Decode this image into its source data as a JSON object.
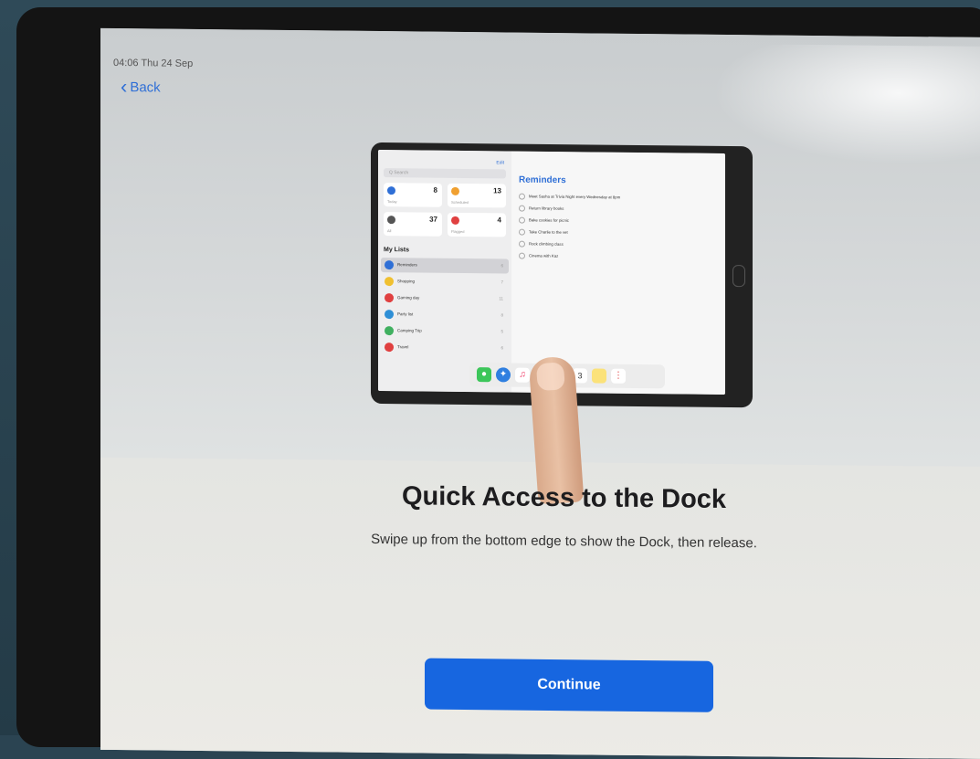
{
  "status_bar": {
    "time_date": "04:06  Thu 24 Sep"
  },
  "nav": {
    "back_label": "Back"
  },
  "illustration": {
    "sidebar": {
      "edit": "Edit",
      "search": "Q Search",
      "tiles": [
        {
          "label": "Today",
          "count": "8",
          "color": "#2f6fd6"
        },
        {
          "label": "Scheduled",
          "count": "13",
          "color": "#f0a030"
        },
        {
          "label": "All",
          "count": "37",
          "color": "#555555"
        },
        {
          "label": "Flagged",
          "count": "4",
          "color": "#e04040"
        }
      ],
      "my_lists_heading": "My Lists",
      "lists": [
        {
          "name": "Reminders",
          "count": "6",
          "color": "#2f6fd6"
        },
        {
          "name": "Shopping",
          "count": "7",
          "color": "#f0c030"
        },
        {
          "name": "Gaming day",
          "count": "11",
          "color": "#e04040"
        },
        {
          "name": "Party list",
          "count": "8",
          "color": "#2f8fd6"
        },
        {
          "name": "Camping Trip",
          "count": "5",
          "color": "#40b060"
        },
        {
          "name": "Travel",
          "count": "6",
          "color": "#e04040"
        }
      ]
    },
    "reminders": {
      "title": "Reminders",
      "items": [
        "Meet Sasha at Trivia Night every Wednesday at 8pm",
        "Return library books",
        "Bake cookies for picnic",
        "Take Charlie to the vet",
        "Rock climbing class",
        "Cinema with Kaz"
      ]
    },
    "dock": {
      "icons": [
        "messages-icon",
        "safari-icon",
        "music-icon",
        "files-icon",
        "mail-icon",
        "calendar-icon",
        "notes-icon",
        "reminders-icon"
      ],
      "calendar_day": "3"
    }
  },
  "main": {
    "title": "Quick Access to the Dock",
    "subtitle": "Swipe up from the bottom edge to show the Dock, then release."
  },
  "actions": {
    "continue_label": "Continue"
  },
  "colors": {
    "accent": "#1766e0",
    "link": "#2f6fd6"
  }
}
